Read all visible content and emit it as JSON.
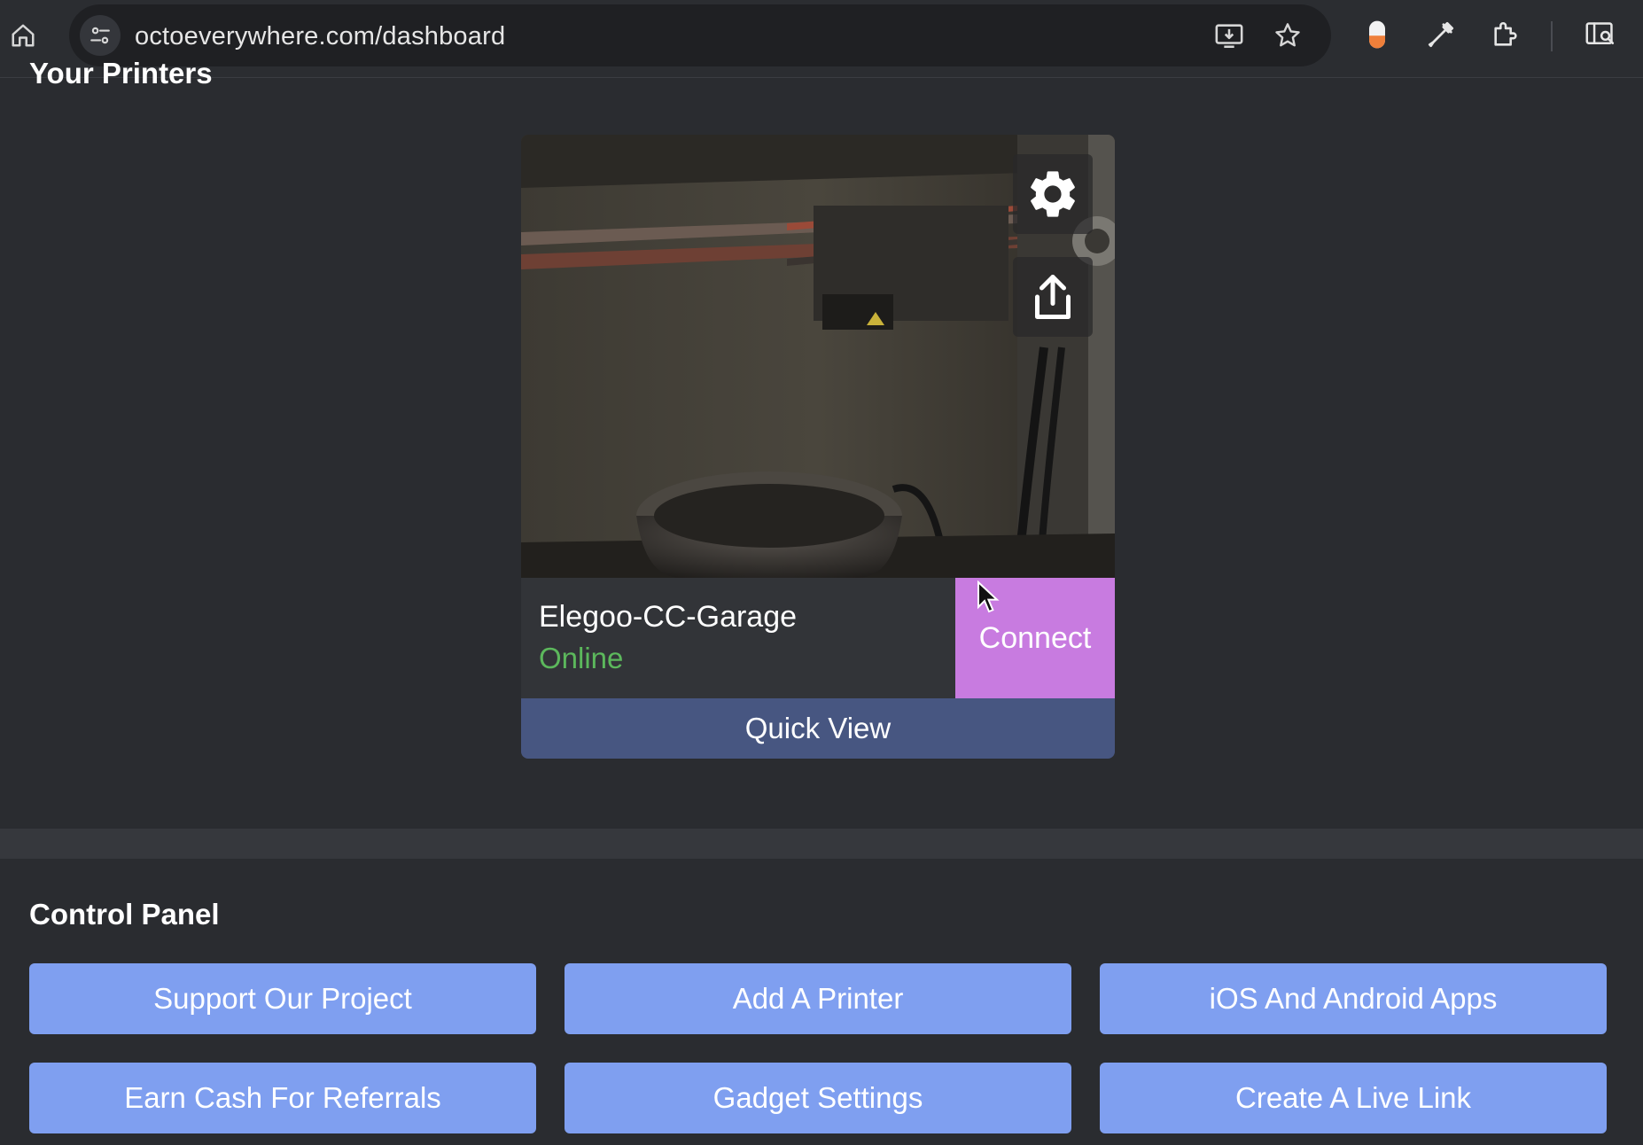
{
  "browser": {
    "url": "octoeverywhere.com/dashboard",
    "icons": [
      "home-icon",
      "site-info-icon",
      "install-app-icon",
      "bookmark-star-icon",
      "extension-pill-icon",
      "eyedropper-icon",
      "extensions-puzzle-icon",
      "side-panel-search-icon"
    ]
  },
  "page": {
    "heading": "Your Printers"
  },
  "printer_card": {
    "name": "Elegoo-CC-Garage",
    "status": "Online",
    "status_color": "#5cb85c",
    "connect_label": "Connect",
    "connect_color": "#c87be0",
    "quick_view_label": "Quick View",
    "quick_view_color": "#475681",
    "overlay_icons": [
      "gear-icon",
      "share-icon"
    ]
  },
  "control_panel": {
    "title": "Control Panel",
    "button_color": "#7f9ff0",
    "buttons": [
      {
        "label": "Support Our Project"
      },
      {
        "label": "Add A Printer"
      },
      {
        "label": "iOS And Android Apps"
      },
      {
        "label": "Earn Cash For Referrals"
      },
      {
        "label": "Gadget Settings"
      },
      {
        "label": "Create A Live Link"
      }
    ]
  }
}
